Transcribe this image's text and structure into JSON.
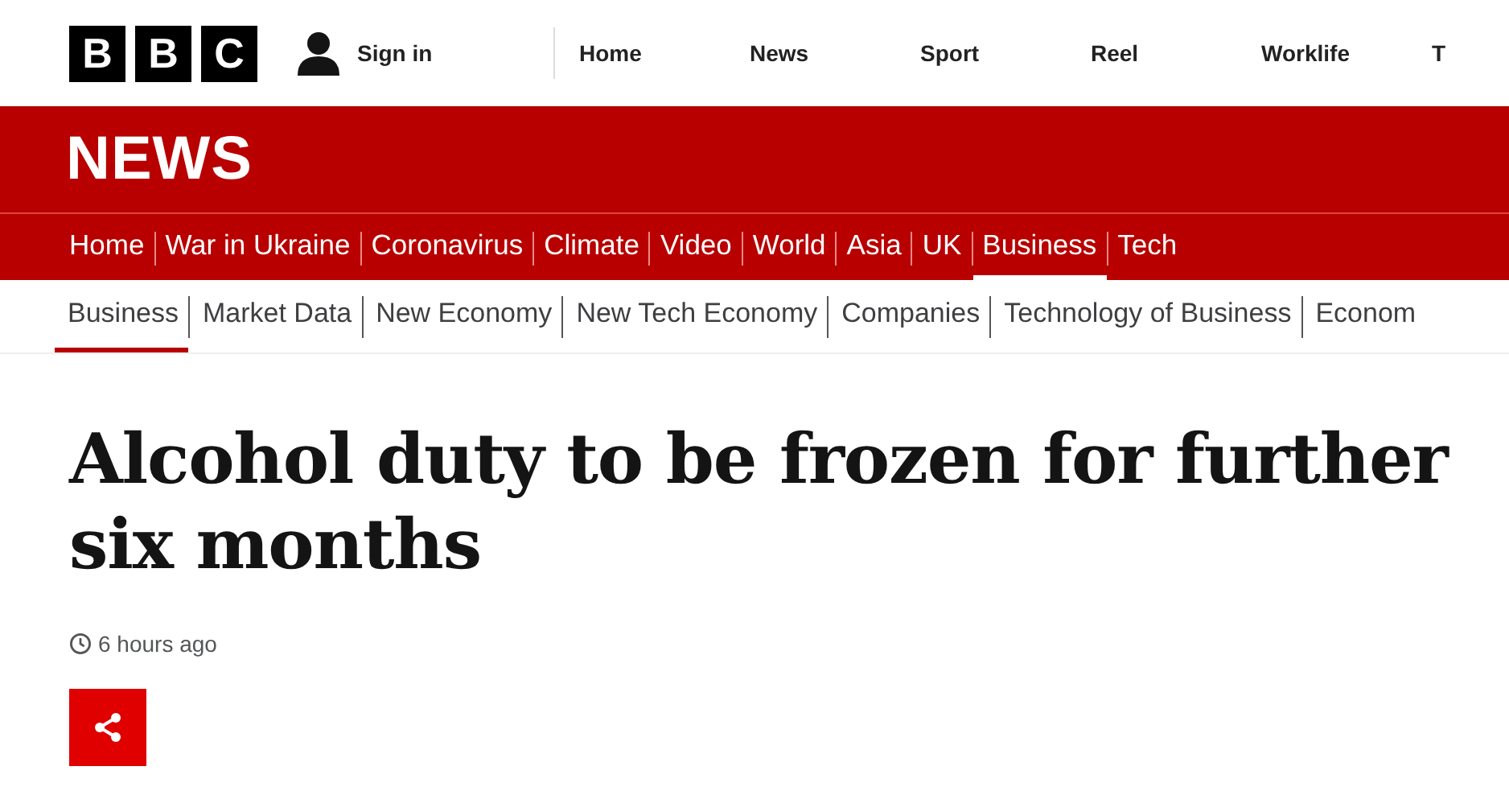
{
  "logo": {
    "letters": [
      "B",
      "B",
      "C"
    ]
  },
  "account": {
    "label": "Sign in"
  },
  "top_nav": [
    {
      "label": "Home"
    },
    {
      "label": "News"
    },
    {
      "label": "Sport"
    },
    {
      "label": "Reel"
    },
    {
      "label": "Worklife"
    },
    {
      "label": "T"
    }
  ],
  "section_title": "NEWS",
  "news_nav": [
    {
      "label": "Home",
      "selected": false
    },
    {
      "label": "War in Ukraine",
      "selected": false
    },
    {
      "label": "Coronavirus",
      "selected": false
    },
    {
      "label": "Climate",
      "selected": false
    },
    {
      "label": "Video",
      "selected": false
    },
    {
      "label": "World",
      "selected": false
    },
    {
      "label": "Asia",
      "selected": false
    },
    {
      "label": "UK",
      "selected": false
    },
    {
      "label": "Business",
      "selected": true
    },
    {
      "label": "Tech",
      "selected": false
    }
  ],
  "sub_nav": [
    {
      "label": "Business",
      "selected": true
    },
    {
      "label": "Market Data",
      "selected": false
    },
    {
      "label": "New Economy",
      "selected": false
    },
    {
      "label": "New Tech Economy",
      "selected": false
    },
    {
      "label": "Companies",
      "selected": false
    },
    {
      "label": "Technology of Business",
      "selected": false
    },
    {
      "label": "Econom",
      "selected": false
    }
  ],
  "article": {
    "headline": "Alcohol duty to be frozen for further six months",
    "timestamp": "6 hours ago"
  }
}
